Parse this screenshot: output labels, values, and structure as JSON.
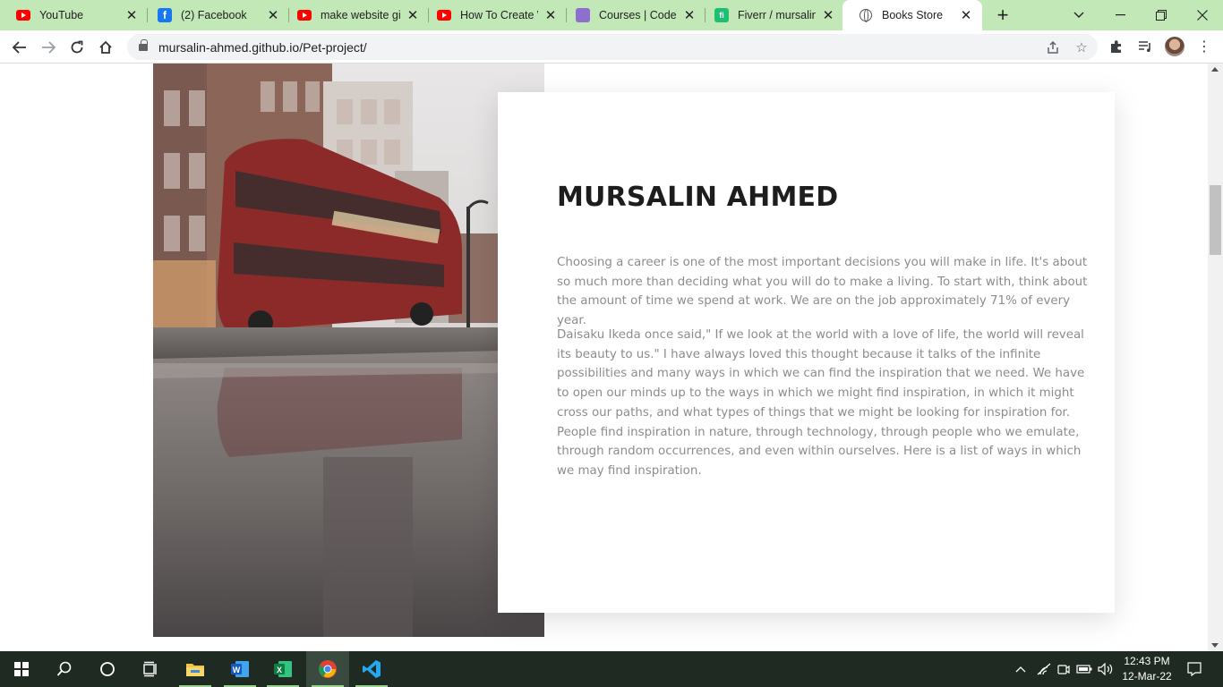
{
  "browser": {
    "tabs": [
      {
        "title": "YouTube",
        "icon": "youtube-icon"
      },
      {
        "title": "(2) Facebook",
        "icon": "facebook-icon"
      },
      {
        "title": "make website gig",
        "icon": "youtube-icon"
      },
      {
        "title": "How To Create W",
        "icon": "youtube-icon"
      },
      {
        "title": "Courses | CodeW",
        "icon": "codewithharry-icon"
      },
      {
        "title": "Fiverr / mursalin",
        "icon": "fiverr-icon"
      },
      {
        "title": "Books Store",
        "icon": "globe-icon",
        "active": true
      }
    ],
    "url": "mursalin-ahmed.github.io/Pet-project/"
  },
  "page": {
    "heading": "MURSALIN AHMED",
    "paragraph1": "Choosing a career is one of the most important decisions you will make in life. It's about so much more than deciding what you will do to make a living. To start with, think about the amount of time we spend at work. We are on the job approximately 71% of every year.",
    "paragraph2": "Daisaku Ikeda once said,\" If we look at the world with a love of life, the world will reveal its beauty to us.\" I have always loved this thought because it talks of the infinite possibilities and many ways in which we can find the inspiration that we need. We have to open our minds up to the ways in which we might find inspiration, in which it might cross our paths, and what types of things that we might be looking for inspiration for. People find inspiration in nature, through technology, through people who we emulate, through random occurrences, and even within ourselves. Here is a list of ways in which we may find inspiration."
  },
  "taskbar": {
    "apps": [
      "start-icon",
      "search-icon",
      "cortana-icon",
      "task-view-icon",
      "file-explorer-icon",
      "word-icon",
      "excel-icon",
      "chrome-icon",
      "vscode-icon"
    ],
    "time": "12:43 PM",
    "date": "12-Mar-22"
  },
  "colors": {
    "tabstrip": "#c2e8b8",
    "taskbar": "#1f2a22",
    "heading": "#1d1d1d",
    "body_text": "#8c8c8c"
  }
}
